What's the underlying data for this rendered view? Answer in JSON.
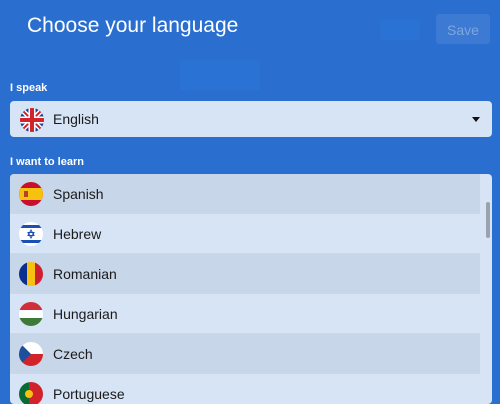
{
  "header": {
    "title": "Choose your language",
    "save_label": "Save"
  },
  "speak": {
    "label": "I speak",
    "selected": {
      "language": "English",
      "flag_icon": "uk-flag-icon"
    }
  },
  "learn": {
    "label": "I want to learn",
    "options": [
      {
        "language": "Spanish",
        "flag_icon": "spain-flag-icon"
      },
      {
        "language": "Hebrew",
        "flag_icon": "israel-flag-icon"
      },
      {
        "language": "Romanian",
        "flag_icon": "romania-flag-icon"
      },
      {
        "language": "Hungarian",
        "flag_icon": "hungary-flag-icon"
      },
      {
        "language": "Czech",
        "flag_icon": "czech-flag-icon"
      },
      {
        "language": "Portuguese",
        "flag_icon": "portugal-flag-icon"
      }
    ]
  },
  "colors": {
    "background": "#2a6fd0",
    "field": "#d6e4f5",
    "row_alt": "#c8d6ea",
    "text": "#1a1a1a"
  }
}
